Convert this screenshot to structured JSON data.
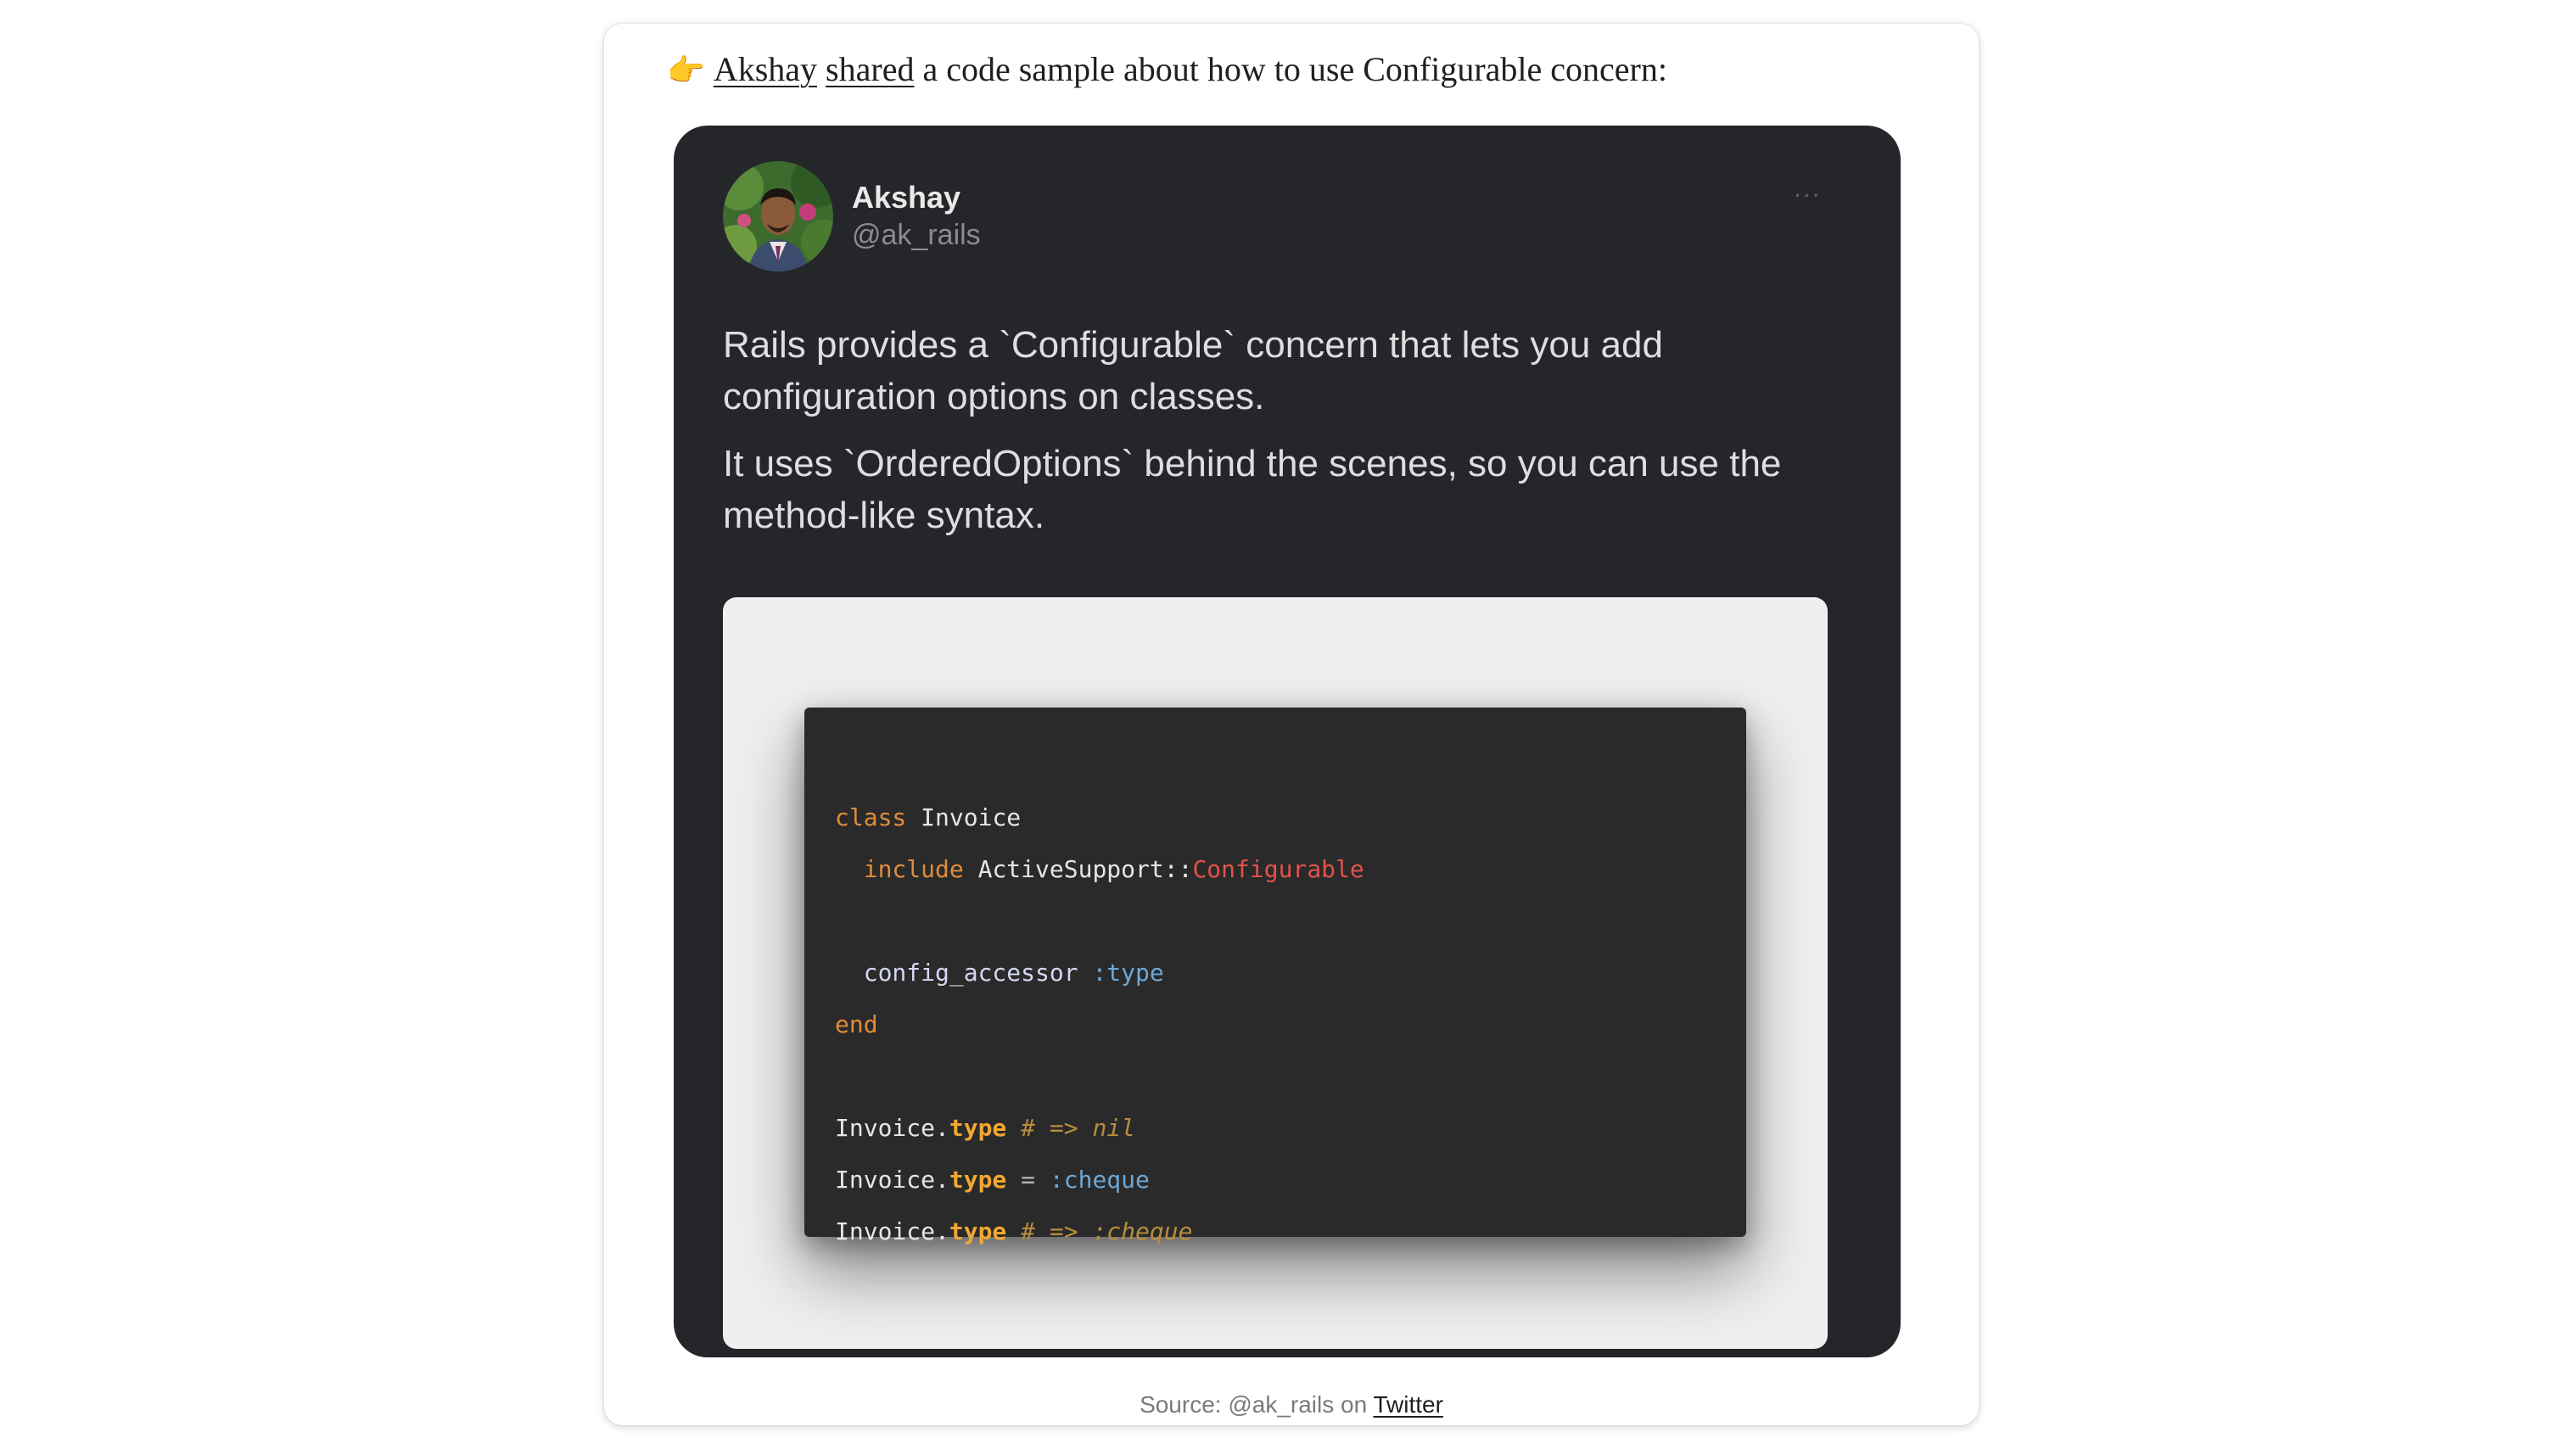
{
  "intro": {
    "emoji": "👉",
    "author_link": "Akshay",
    "shared_link": "shared",
    "rest": " a code sample about how to use Configurable concern:"
  },
  "tweet": {
    "author_name": "Akshay",
    "author_handle": "@ak_rails",
    "more_label": "···",
    "paragraphs": [
      "Rails provides a `Configurable` concern that lets you add configuration options on classes.",
      "It uses `OrderedOptions` behind the scenes, so you can use the method-like syntax."
    ]
  },
  "code": {
    "line1": {
      "kw": "class",
      "name": " Invoice"
    },
    "line2": {
      "kw": "include",
      "mod": " ActiveSupport::",
      "const": "Configurable"
    },
    "line4": {
      "ident": "config_accessor",
      "sym": " :type"
    },
    "line5": {
      "kw": "end"
    },
    "line7": {
      "obj": "Invoice.",
      "method": "type",
      "comment": " # => nil"
    },
    "line8": {
      "obj": "Invoice.",
      "method": "type",
      "op": " = ",
      "sym": ":cheque"
    },
    "line9": {
      "obj": "Invoice.",
      "method": "type",
      "comment": " # => :cheque"
    }
  },
  "source": {
    "prefix": "Source: @ak_rails on ",
    "link": "Twitter"
  },
  "colors": {
    "tweet_bg": "#25262a",
    "code_bg": "#2a2a2a",
    "keyword": "#e08c3b",
    "constant": "#e2524b",
    "symbol": "#6da8d6",
    "method": "#f0a832"
  }
}
